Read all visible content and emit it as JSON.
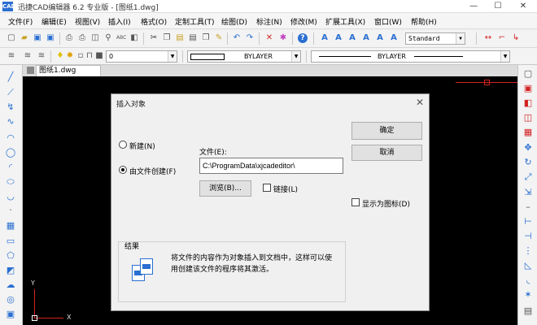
{
  "window": {
    "title": "迅捷CAD编辑器 6.2 专业版 - [图纸1.dwg]",
    "app_icon_text": "CAD",
    "controls": [
      "—",
      "☐",
      "✕"
    ]
  },
  "menu": [
    "文件(F)",
    "编辑(E)",
    "视图(V)",
    "插入(I)",
    "格式(O)",
    "定制工具(T)",
    "绘图(D)",
    "标注(N)",
    "修改(M)",
    "扩展工具(X)",
    "窗口(W)",
    "帮助(H)"
  ],
  "toolbar": {
    "text_style": "Standard",
    "layer_value": "0",
    "color_value": "BYLAYER",
    "linetype_value": "BYLAYER"
  },
  "document_tab": "图纸1.dwg",
  "canvas": {
    "axis_y": "Y",
    "axis_x": "X"
  },
  "dialog": {
    "title": "插入对象",
    "close": "✕",
    "radio_new": "新建(N)",
    "radio_from_file": "由文件创建(F)",
    "from_file_selected": true,
    "file_label": "文件(E):",
    "file_value": "C:\\ProgramData\\xjcadeditor\\",
    "browse_button": "浏览(B)...",
    "link_label": "链接(L)",
    "ok_button": "确定",
    "cancel_button": "取消",
    "display_as_icon_label": "显示为图标(D)",
    "result_title": "结果",
    "result_text_line1": "将文件的内容作为对象插入到文档中，这样可以使",
    "result_text_line2": "用创建该文件的程序将其激活。"
  },
  "colors": {
    "canvas": "#000000",
    "dialog_bg": "#f0f0f0",
    "accent_blue": "#2a6fd1",
    "red": "#d22222"
  }
}
